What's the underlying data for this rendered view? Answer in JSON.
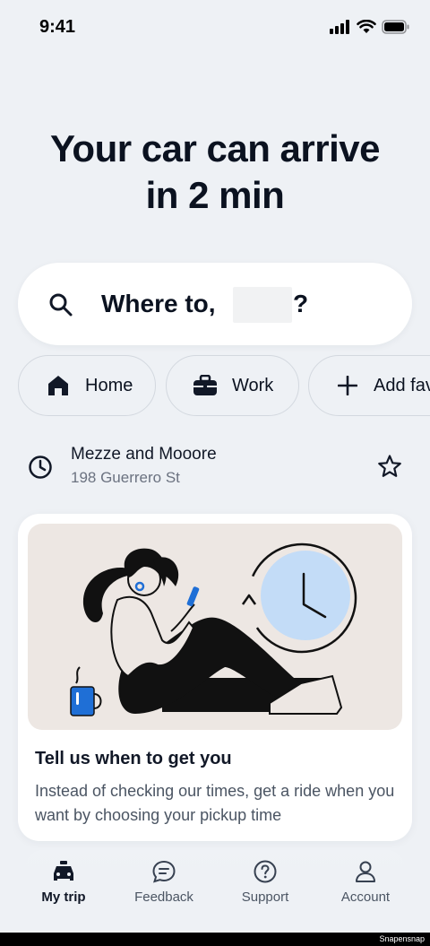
{
  "status": {
    "time": "9:41"
  },
  "hero": {
    "line1": "Your car can arrive",
    "line2": "in 2 min"
  },
  "search": {
    "prompt": "Where to,",
    "suffix": "?"
  },
  "chips": [
    {
      "label": "Home",
      "icon": "home-icon"
    },
    {
      "label": "Work",
      "icon": "briefcase-icon"
    },
    {
      "label": "Add fav",
      "icon": "plus-icon"
    }
  ],
  "recent": {
    "name": "Mezze and Mooore",
    "address": "198 Guerrero St",
    "icon": "clock-icon"
  },
  "promo": {
    "title": "Tell us when to get you",
    "body": "Instead of checking our times, get a ride when you want by choosing your pickup time"
  },
  "nav": [
    {
      "label": "My trip",
      "icon": "car-icon",
      "active": true
    },
    {
      "label": "Feedback",
      "icon": "chat-icon",
      "active": false
    },
    {
      "label": "Support",
      "icon": "help-icon",
      "active": false
    },
    {
      "label": "Account",
      "icon": "user-icon",
      "active": false
    }
  ],
  "watermark": "Snapensnap",
  "colors": {
    "background": "#eef1f5",
    "accent": "#1f6fd6",
    "clock_face": "#c3dcf7"
  }
}
